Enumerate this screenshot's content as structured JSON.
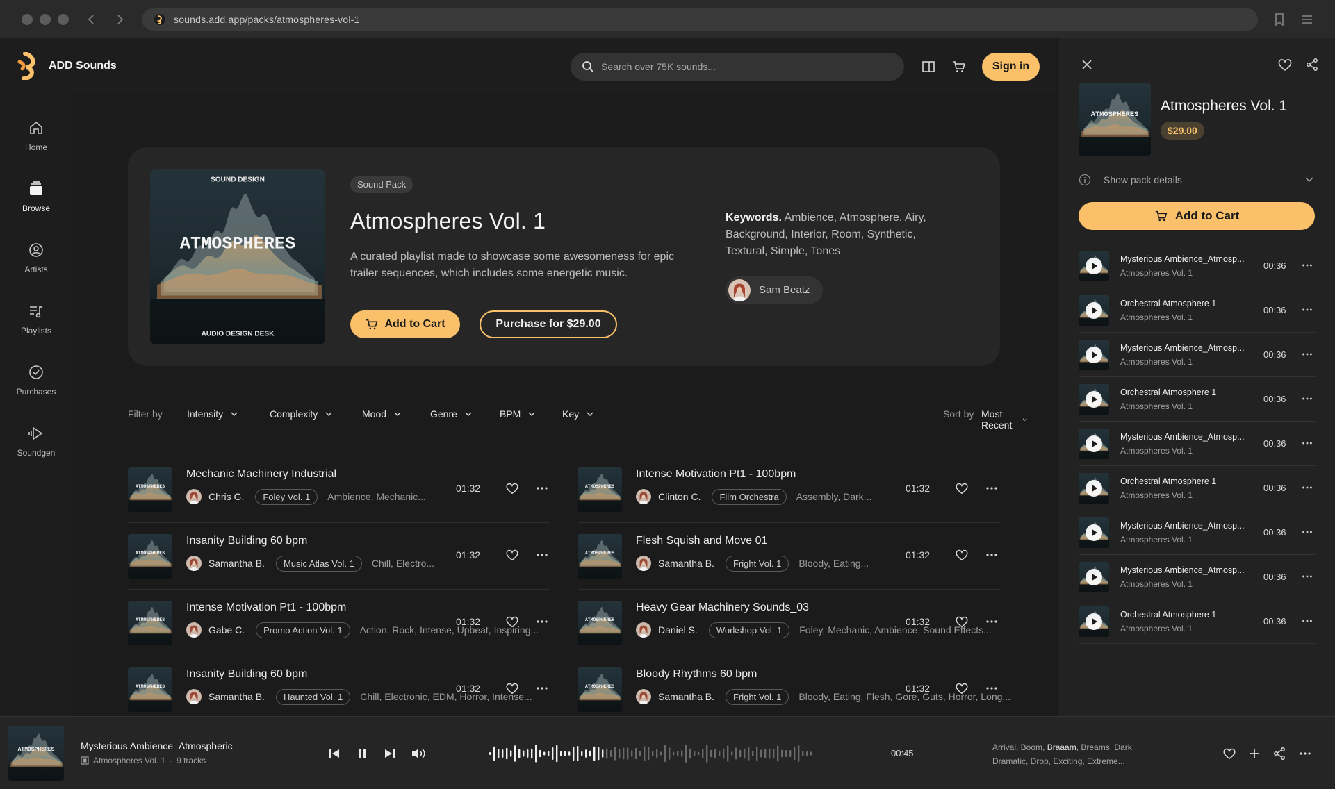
{
  "browser": {
    "url": "sounds.add.app/packs/atmospheres-vol-1"
  },
  "header": {
    "brand": "ADD Sounds",
    "search_placeholder": "Search over 75K sounds...",
    "signin_label": "Sign in"
  },
  "sidebar": {
    "items": [
      {
        "label": "Home",
        "icon": "home-icon"
      },
      {
        "label": "Browse",
        "icon": "browse-icon"
      },
      {
        "label": "Artists",
        "icon": "artists-icon"
      },
      {
        "label": "Playlists",
        "icon": "playlists-icon"
      },
      {
        "label": "Purchases",
        "icon": "purchases-icon"
      },
      {
        "label": "Soundgen",
        "icon": "soundgen-icon"
      }
    ],
    "active_index": 1
  },
  "cover_art": {
    "top_text": "SOUND DESIGN",
    "main_text": "ATMOSPHERES",
    "bottom_text": "AUDIO DESIGN DESK"
  },
  "hero": {
    "tag": "Sound Pack",
    "title": "Atmospheres Vol. 1",
    "description": "A curated playlist made to showcase some awesomeness for epic trailer sequences, which includes some energetic music.",
    "add_to_cart_label": "Add to Cart",
    "purchase_label": "Purchase for $29.00",
    "keywords_label": "Keywords.",
    "keywords": "Ambience, Atmosphere, Airy, Background, Interior, Room, Synthetic, Textural, Simple, Tones",
    "artist": "Sam Beatz"
  },
  "filters": {
    "label": "Filter by",
    "items": [
      "Intensity",
      "Complexity",
      "Mood",
      "Genre",
      "BPM",
      "Key"
    ],
    "sort_label": "Sort by",
    "sort_value": "Most Recent"
  },
  "tracks": [
    {
      "title": "Mechanic Machinery Industrial",
      "artist": "Chris G.",
      "pack": "Foley Vol. 1",
      "tags": "Ambience, Mechanic...",
      "duration": "01:32"
    },
    {
      "title": "Intense Motivation Pt1 - 100bpm",
      "artist": "Clinton C.",
      "pack": "Film Orchestra",
      "tags": "Assembly, Dark...",
      "duration": "01:32"
    },
    {
      "title": "Insanity Building 60 bpm",
      "artist": "Samantha B.",
      "pack": "Music Atlas Vol. 1",
      "tags": "Chill, Electro...",
      "duration": "01:32"
    },
    {
      "title": "Flesh Squish and Move 01",
      "artist": "Samantha B.",
      "pack": "Fright Vol. 1",
      "tags": "Bloody, Eating...",
      "duration": "01:32"
    },
    {
      "title": "Intense Motivation Pt1 - 100bpm",
      "artist": "Gabe C.",
      "pack": "Promo Action Vol. 1",
      "tags": "Action, Rock, Intense, Upbeat, Inspiring...",
      "duration": "01:32"
    },
    {
      "title": "Heavy Gear Machinery Sounds_03",
      "artist": "Daniel S.",
      "pack": "Workshop Vol. 1",
      "tags": "Foley, Mechanic, Ambience, Sound Effects...",
      "duration": "01:32"
    },
    {
      "title": "Insanity Building 60 bpm",
      "artist": "Samantha B.",
      "pack": "Haunted Vol. 1",
      "tags": "Chill, Electronic, EDM, Horror, Intense...",
      "duration": "01:32"
    },
    {
      "title": "Bloody Rhythms 60 bpm",
      "artist": "Samantha B.",
      "pack": "Fright Vol. 1",
      "tags": "Bloody, Eating, Flesh, Gore, Guts, Horror, Long...",
      "duration": "01:32"
    }
  ],
  "panel": {
    "title": "Atmospheres Vol. 1",
    "price": "$29.00",
    "show_details_label": "Show pack details",
    "add_to_cart_label": "Add to Cart",
    "tracks": [
      {
        "title": "Mysterious Ambience_Atmosp...",
        "sub": "Atmospheres Vol. 1",
        "duration": "00:36"
      },
      {
        "title": "Orchestral Atmosphere 1",
        "sub": "Atmospheres Vol. 1",
        "duration": "00:36"
      },
      {
        "title": "Mysterious Ambience_Atmosp...",
        "sub": "Atmospheres Vol. 1",
        "duration": "00:36"
      },
      {
        "title": "Orchestral Atmosphere 1",
        "sub": "Atmospheres Vol. 1",
        "duration": "00:36"
      },
      {
        "title": "Mysterious Ambience_Atmosp...",
        "sub": "Atmospheres Vol. 1",
        "duration": "00:36"
      },
      {
        "title": "Orchestral Atmosphere 1",
        "sub": "Atmospheres Vol. 1",
        "duration": "00:36"
      },
      {
        "title": "Mysterious Ambience_Atmosp...",
        "sub": "Atmospheres Vol. 1",
        "duration": "00:36"
      },
      {
        "title": "Mysterious Ambience_Atmosp...",
        "sub": "Atmospheres Vol. 1",
        "duration": "00:36"
      },
      {
        "title": "Orchestral Atmosphere 1",
        "sub": "Atmospheres Vol. 1",
        "duration": "00:36"
      }
    ]
  },
  "player": {
    "title": "Mysterious Ambience_Atmospheric",
    "pack": "Atmospheres Vol. 1",
    "track_count": "9 tracks",
    "separator": "·",
    "time": "00:45",
    "tags_prefix": "Arrival, Boom, ",
    "tags_highlight": "Braaam",
    "tags_suffix": ", Breams, Dark, Dramatic, Drop, Exciting, Extreme..."
  },
  "colors": {
    "accent": "#fbc16a",
    "background": "#1b1b1b",
    "card": "#262626"
  }
}
